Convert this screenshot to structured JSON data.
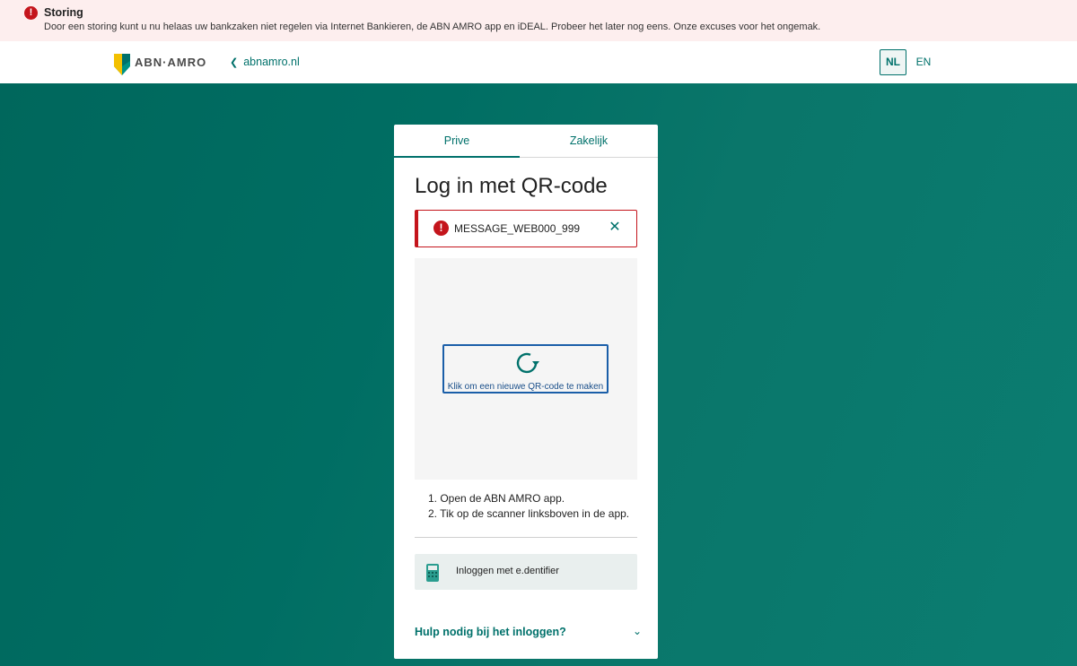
{
  "alert": {
    "title": "Storing",
    "message": "Door een storing kunt u nu helaas uw bankzaken niet regelen via Internet Bankieren, de ABN AMRO app en iDEAL. Probeer het later nog eens. Onze excuses voor het ongemak."
  },
  "header": {
    "logo_text": "ABN·AMRO",
    "back_link": "abnamro.nl",
    "lang_nl": "NL",
    "lang_en": "EN"
  },
  "card": {
    "tabs": [
      {
        "label": "Prive",
        "active": true
      },
      {
        "label": "Zakelijk",
        "active": false
      }
    ],
    "title": "Log in met QR-code",
    "error_message": "MESSAGE_WEB000_999",
    "refresh_label": "Klik om een nieuwe QR-code te maken",
    "steps": [
      "1. Open de ABN AMRO app.",
      "2. Tik op de scanner linksboven in de app."
    ],
    "edentifier_label": "Inloggen met e.dentifier",
    "help_label": "Hulp nodig bij het inloggen?"
  },
  "colors": {
    "brand_green": "#00716b",
    "error_red": "#c4151c",
    "background_teal": "#006e62",
    "refresh_blue": "#1a5ea8"
  },
  "icons": {
    "alert": "exclamation-circle-icon",
    "back": "chevron-left-icon",
    "close": "close-icon",
    "refresh": "refresh-icon",
    "edentifier": "card-reader-icon",
    "help_toggle": "chevron-down-icon"
  }
}
